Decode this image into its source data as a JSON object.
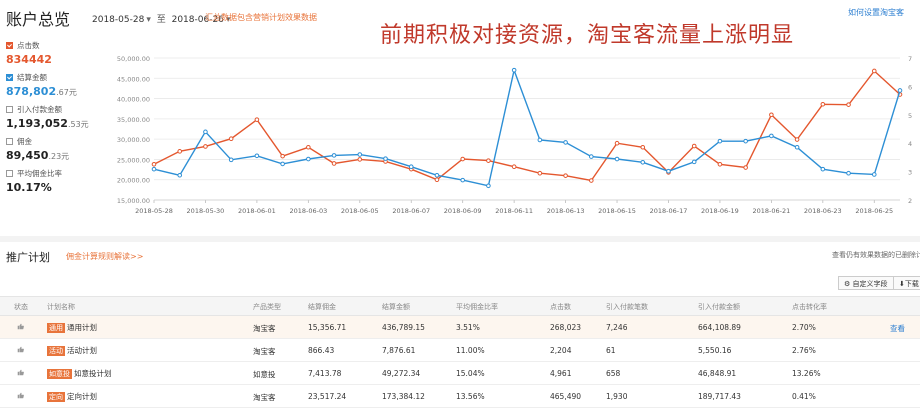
{
  "header": {
    "title": "账户总览",
    "date_start": "2018-05-28",
    "date_sep": "至",
    "date_end": "2018-06-26",
    "note_link": "汇总数据包含营销计划效果数据",
    "howto_link": "如何设置淘宝客",
    "banner": "前期积极对接资源，淘宝客流量上涨明显"
  },
  "metrics": [
    {
      "label": "点击数",
      "value": "834442",
      "frac": "",
      "checked": "red"
    },
    {
      "label": "结算金额",
      "value": "878,802",
      "frac": ".67元",
      "checked": "blue"
    },
    {
      "label": "引入付款金额",
      "value": "1,193,052",
      "frac": ".53元",
      "checked": ""
    },
    {
      "label": "佣金",
      "value": "89,450",
      "frac": ".23元",
      "checked": ""
    },
    {
      "label": "平均佣金比率",
      "value": "10.17%",
      "frac": "",
      "checked": ""
    }
  ],
  "chart_data": {
    "type": "line",
    "x": [
      "2018-05-28",
      "2018-05-29",
      "2018-05-30",
      "2018-05-31",
      "2018-06-01",
      "2018-06-02",
      "2018-06-03",
      "2018-06-04",
      "2018-06-05",
      "2018-06-06",
      "2018-06-07",
      "2018-06-08",
      "2018-06-09",
      "2018-06-10",
      "2018-06-11",
      "2018-06-12",
      "2018-06-13",
      "2018-06-14",
      "2018-06-15",
      "2018-06-16",
      "2018-06-17",
      "2018-06-18",
      "2018-06-19",
      "2018-06-20",
      "2018-06-21",
      "2018-06-22",
      "2018-06-23",
      "2018-06-24",
      "2018-06-25",
      "2018-06-26"
    ],
    "x_tick_labels": [
      "2018-05-28",
      "2018-05-30",
      "2018-06-01",
      "2018-06-03",
      "2018-06-05",
      "2018-06-07",
      "2018-06-09",
      "2018-06-11",
      "2018-06-13",
      "2018-06-15",
      "2018-06-17",
      "2018-06-19",
      "2018-06-21",
      "2018-06-23",
      "2018-06-25"
    ],
    "left_axis": {
      "ylim": [
        15000,
        50000
      ],
      "ticks": [
        "15,000.00",
        "20,000.00",
        "25,000.00",
        "30,000.00",
        "35,000.00",
        "40,000.00",
        "45,000.00",
        "50,000.00"
      ]
    },
    "right_axis": {
      "ticks": [
        "2",
        "3",
        "4",
        "5",
        "6",
        "7"
      ]
    },
    "series": [
      {
        "color": "#e4572e",
        "axis": "left",
        "values": [
          23800,
          27000,
          28200,
          30100,
          34800,
          25800,
          28000,
          24000,
          25000,
          24500,
          22600,
          20000,
          25100,
          24700,
          23200,
          21600,
          21000,
          19800,
          29000,
          28000,
          21800,
          28300,
          23800,
          23000,
          36000,
          29900,
          38600,
          38500,
          46800,
          41000
        ]
      },
      {
        "color": "#2d8fd5",
        "axis": "left",
        "values": [
          22600,
          21100,
          31800,
          24900,
          25900,
          23900,
          25100,
          26000,
          26200,
          25200,
          23200,
          21100,
          19900,
          18500,
          47000,
          29800,
          29200,
          25700,
          25100,
          24300,
          22100,
          24400,
          29500,
          29500,
          30800,
          28000,
          22600,
          21600,
          21300,
          42000
        ]
      }
    ],
    "grid": true
  },
  "plans": {
    "section_title": "推广计划",
    "rules_link": "佣金计算规则解读>>",
    "view_link": "查看仍有效果数据的已删除计",
    "custom_fields_btn": "自定义字段",
    "download_btn": "下载",
    "columns": [
      "状态",
      "计划名称",
      "产品类型",
      "结算佣金",
      "结算金额",
      "平均佣金比率",
      "点击数",
      "引入付款笔数",
      "引入付款金额",
      "点击转化率"
    ],
    "rows": [
      {
        "tag": "通用",
        "name": "通用计划",
        "type": "淘宝客",
        "commission": "15,356.71",
        "amount": "436,789.15",
        "rate": "3.51%",
        "clicks": "268,023",
        "orders": "7,246",
        "pay_amount": "664,108.89",
        "conv": "2.70%",
        "action": "查看"
      },
      {
        "tag": "活动",
        "name": "活动计划",
        "type": "淘宝客",
        "commission": "866.43",
        "amount": "7,876.61",
        "rate": "11.00%",
        "clicks": "2,204",
        "orders": "61",
        "pay_amount": "5,550.16",
        "conv": "2.76%",
        "action": ""
      },
      {
        "tag": "如意投",
        "name": "如意投计划",
        "type": "如意投",
        "commission": "7,413.78",
        "amount": "49,272.34",
        "rate": "15.04%",
        "clicks": "4,961",
        "orders": "658",
        "pay_amount": "46,848.91",
        "conv": "13.26%",
        "action": ""
      },
      {
        "tag": "定向",
        "name": "定向计划",
        "type": "淘宝客",
        "commission": "23,517.24",
        "amount": "173,384.12",
        "rate": "13.56%",
        "clicks": "465,490",
        "orders": "1,930",
        "pay_amount": "189,717.43",
        "conv": "0.41%",
        "action": ""
      }
    ]
  }
}
